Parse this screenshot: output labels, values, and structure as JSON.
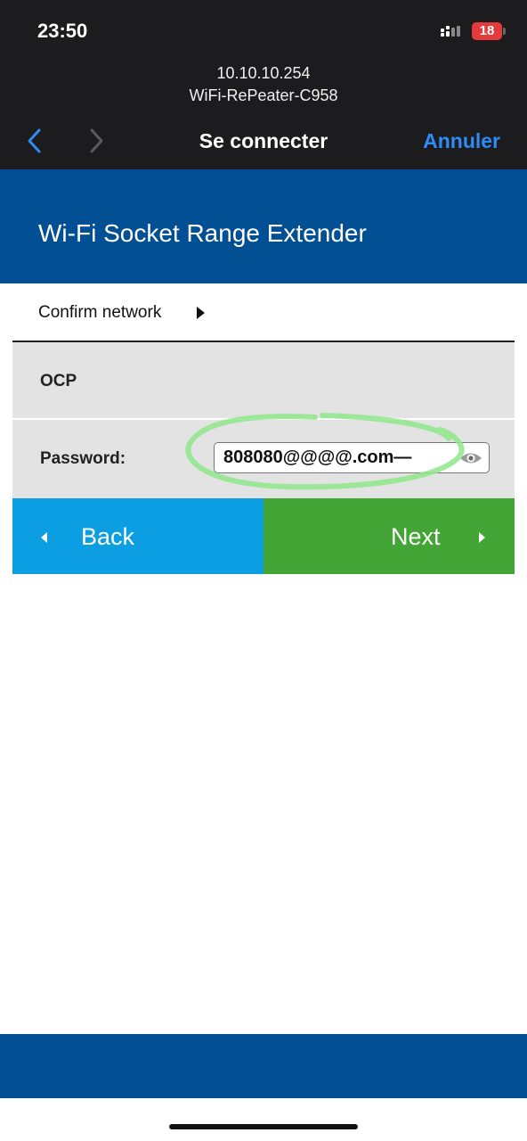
{
  "status_bar": {
    "time": "23:50",
    "battery": "18",
    "signal_icon": "cellular-signal-icon",
    "battery_color": "#e33b3b"
  },
  "browser": {
    "url": "10.10.10.254",
    "page_name": "WiFi-RePeater-C958",
    "title": "Se connecter",
    "cancel_label": "Annuler",
    "back_icon": "chevron-left-icon",
    "forward_icon": "chevron-right-icon",
    "accent_color": "#2f8bf5"
  },
  "app": {
    "title": "Wi-Fi Socket Range Extender",
    "header_color": "#034f93"
  },
  "form": {
    "confirm_label": "Confirm network",
    "network_name": "OCP",
    "password_label": "Password:",
    "password_value": "808080@@@@.com—",
    "reveal_icon": "eye-icon"
  },
  "buttons": {
    "back_label": "Back",
    "next_label": "Next",
    "back_color": "#0c9ee2",
    "next_color": "#43a535"
  }
}
